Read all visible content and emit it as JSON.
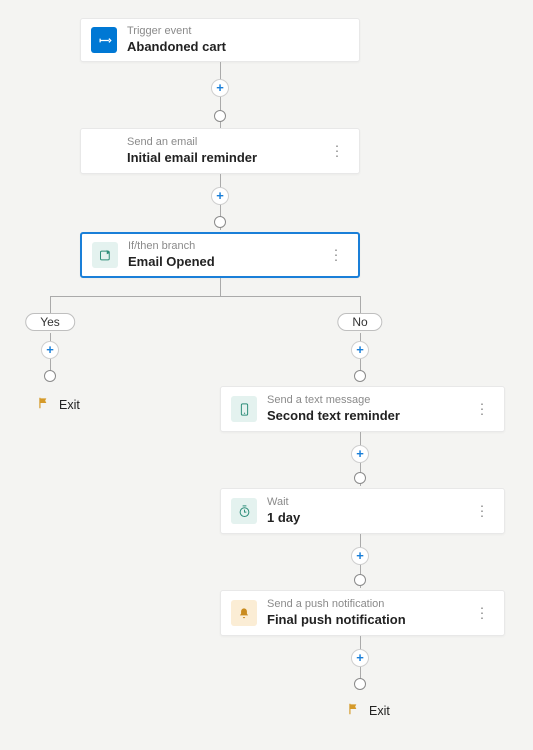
{
  "nodes": {
    "trigger": {
      "type": "Trigger event",
      "title": "Abandoned cart"
    },
    "email": {
      "type": "Send an email",
      "title": "Initial email reminder"
    },
    "branch": {
      "type": "If/then branch",
      "title": "Email Opened"
    },
    "sms": {
      "type": "Send a text message",
      "title": "Second text reminder"
    },
    "wait": {
      "type": "Wait",
      "title": "1 day"
    },
    "push": {
      "type": "Send a push notification",
      "title": "Final push notification"
    }
  },
  "branch_labels": {
    "yes": "Yes",
    "no": "No"
  },
  "exit_label": "Exit"
}
